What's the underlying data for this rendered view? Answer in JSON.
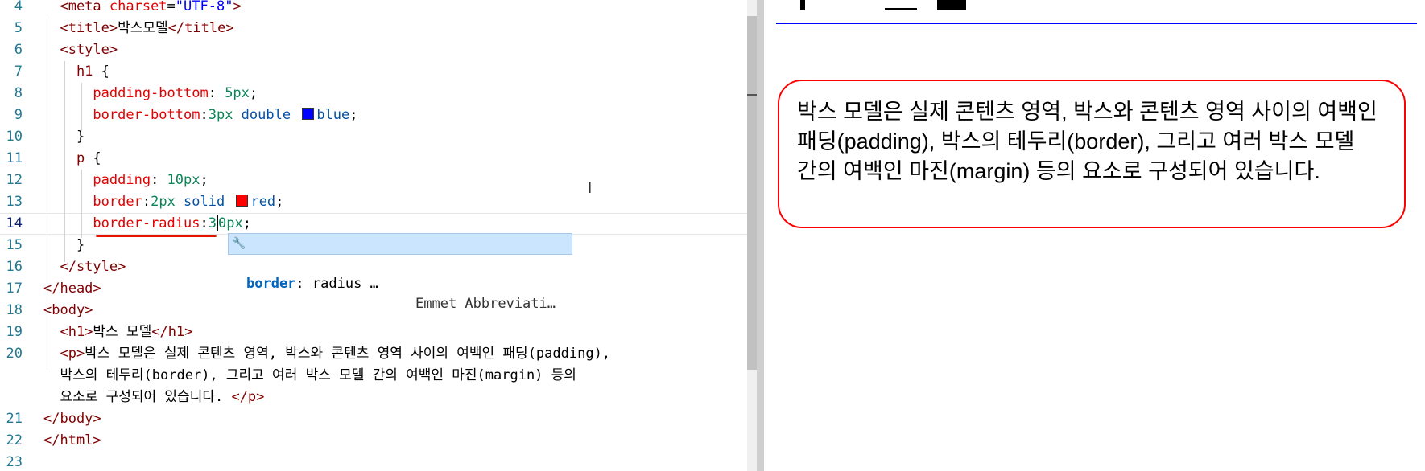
{
  "editor": {
    "lines": [
      {
        "no": "4",
        "tokens": [
          [
            "t-tag",
            "  <meta "
          ],
          [
            "t-attr",
            "charset"
          ],
          [
            "t-plain",
            "="
          ],
          [
            "t-str",
            "\"UTF-8\""
          ],
          [
            "t-tag",
            ">"
          ]
        ]
      },
      {
        "no": "5",
        "tokens": [
          [
            "t-tag",
            "  <title>"
          ],
          [
            "t-plain",
            "박스모델"
          ],
          [
            "t-tag",
            "</title>"
          ]
        ]
      },
      {
        "no": "6",
        "tokens": [
          [
            "t-tag",
            "  <style>"
          ]
        ]
      },
      {
        "no": "7",
        "tokens": [
          [
            "t-sel",
            "    h1 "
          ],
          [
            "t-plain",
            "{"
          ]
        ]
      },
      {
        "no": "8",
        "tokens": [
          [
            "t-prop",
            "      padding-bottom"
          ],
          [
            "t-plain",
            ": "
          ],
          [
            "t-num",
            "5px"
          ],
          [
            "t-plain",
            ";"
          ]
        ]
      },
      {
        "no": "9",
        "tokens": [
          [
            "t-prop",
            "      border-bottom"
          ],
          [
            "t-plain",
            ":"
          ],
          [
            "t-num",
            "3px "
          ],
          [
            "t-val",
            "double "
          ],
          [
            "swatch",
            "#0000ff"
          ],
          [
            "t-val",
            "blue"
          ],
          [
            "t-plain",
            ";"
          ]
        ]
      },
      {
        "no": "10",
        "tokens": [
          [
            "t-plain",
            "    }"
          ]
        ]
      },
      {
        "no": "11",
        "tokens": [
          [
            "t-sel",
            "    p "
          ],
          [
            "t-plain",
            "{"
          ]
        ]
      },
      {
        "no": "12",
        "tokens": [
          [
            "t-prop",
            "      padding"
          ],
          [
            "t-plain",
            ": "
          ],
          [
            "t-num",
            "10px"
          ],
          [
            "t-plain",
            ";"
          ]
        ]
      },
      {
        "no": "13",
        "tokens": [
          [
            "t-prop",
            "      border"
          ],
          [
            "t-plain",
            ":"
          ],
          [
            "t-num",
            "2px "
          ],
          [
            "t-val",
            "solid "
          ],
          [
            "swatch",
            "#ff0000"
          ],
          [
            "t-val",
            "red"
          ],
          [
            "t-plain",
            ";"
          ]
        ]
      },
      {
        "no": "14",
        "tokens": [
          [
            "t-prop",
            "      border-radius"
          ],
          [
            "t-plain",
            ":"
          ],
          [
            "t-num",
            "3"
          ],
          [
            "cursor",
            ""
          ],
          [
            "t-num",
            "0px"
          ],
          [
            "t-plain",
            ";"
          ]
        ]
      },
      {
        "no": "15",
        "tokens": [
          [
            "t-plain",
            "    }"
          ]
        ]
      },
      {
        "no": "16",
        "tokens": [
          [
            "t-tag",
            "  </style>"
          ]
        ]
      },
      {
        "no": "17",
        "tokens": [
          [
            "t-tag",
            "</head>"
          ]
        ]
      },
      {
        "no": "18",
        "tokens": [
          [
            "t-tag",
            "<body>"
          ]
        ]
      },
      {
        "no": "19",
        "tokens": [
          [
            "t-tag",
            "  <h1>"
          ],
          [
            "t-plain",
            "박스 모델"
          ],
          [
            "t-tag",
            "</h1>"
          ]
        ]
      },
      {
        "no": "20",
        "tokens": [
          [
            "t-tag",
            "  <p>"
          ],
          [
            "t-plain",
            "박스 모델은 실제 콘텐츠 영역, 박스와 콘텐츠 영역 사이의 여백인 패딩(padding),"
          ]
        ]
      },
      {
        "no": "",
        "tokens": [
          [
            "t-plain",
            "  박스의 테두리(border), 그리고 여러 박스 모델 간의 여백인 마진(margin) 등의"
          ]
        ]
      },
      {
        "no": "",
        "tokens": [
          [
            "t-plain",
            "  요소로 구성되어 있습니다. "
          ],
          [
            "t-tag",
            "</p>"
          ]
        ]
      },
      {
        "no": "21",
        "tokens": [
          [
            "t-tag",
            "</body>"
          ]
        ]
      },
      {
        "no": "22",
        "tokens": [
          [
            "t-tag",
            "</html>"
          ]
        ]
      },
      {
        "no": "23",
        "tokens": []
      }
    ],
    "current_line": "14",
    "suggestion": {
      "label_bold": "border",
      "label_rest": ": radius …",
      "detail": "Emmet Abbreviati…"
    }
  },
  "preview": {
    "paragraph": "박스 모델은 실제 콘텐츠 영역, 박스와 콘텐츠 영역 사이의 여백인 패딩(padding), 박스의 테두리(border), 그리고 여러 박스 모델 간의 여백인 마진(margin) 등의 요소로 구성되어 있습니다."
  }
}
